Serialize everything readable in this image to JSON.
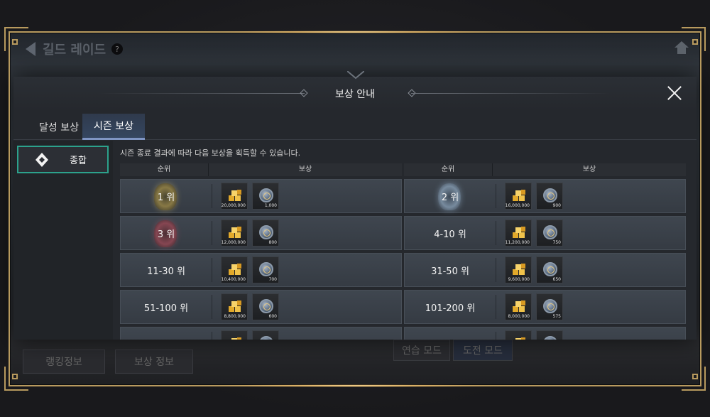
{
  "background": {
    "title": "길드 레이드",
    "help_icon": "?",
    "ranking_button": "랭킹정보",
    "reward_info_button": "보상 정보",
    "practice_mode": "연습 모드",
    "challenge_mode": "도전 모드"
  },
  "modal": {
    "title": "보상 안내",
    "tabs": [
      "달성 보상",
      "시즌 보상"
    ],
    "active_tab": "시즌 보상",
    "sidebar": [
      {
        "label": "종합",
        "icon": "guild-emblem-icon"
      }
    ],
    "description": "시즌 종료 결과에 따라 다음 보상을 획득할 수 있습니다.",
    "headers": {
      "rank": "순위",
      "reward": "보상"
    },
    "left_rows": [
      {
        "rank": "1 위",
        "emblem": "gold",
        "gold_qty": "20,000,000",
        "medal_qty": "1,000"
      },
      {
        "rank": "3 위",
        "emblem": "red",
        "gold_qty": "12,000,000",
        "medal_qty": "800"
      },
      {
        "rank": "11-30 위",
        "emblem": "",
        "gold_qty": "10,400,000",
        "medal_qty": "700"
      },
      {
        "rank": "51-100 위",
        "emblem": "",
        "gold_qty": "8,800,000",
        "medal_qty": "600"
      },
      {
        "rank": "",
        "emblem": "",
        "gold_qty": "",
        "medal_qty": ""
      }
    ],
    "right_rows": [
      {
        "rank": "2 위",
        "emblem": "silver",
        "gold_qty": "16,000,000",
        "medal_qty": "900"
      },
      {
        "rank": "4-10 위",
        "emblem": "",
        "gold_qty": "11,200,000",
        "medal_qty": "750"
      },
      {
        "rank": "31-50 위",
        "emblem": "",
        "gold_qty": "9,600,000",
        "medal_qty": "650"
      },
      {
        "rank": "101-200 위",
        "emblem": "",
        "gold_qty": "8,000,000",
        "medal_qty": "575"
      },
      {
        "rank": "",
        "emblem": "",
        "gold_qty": "",
        "medal_qty": ""
      }
    ]
  }
}
